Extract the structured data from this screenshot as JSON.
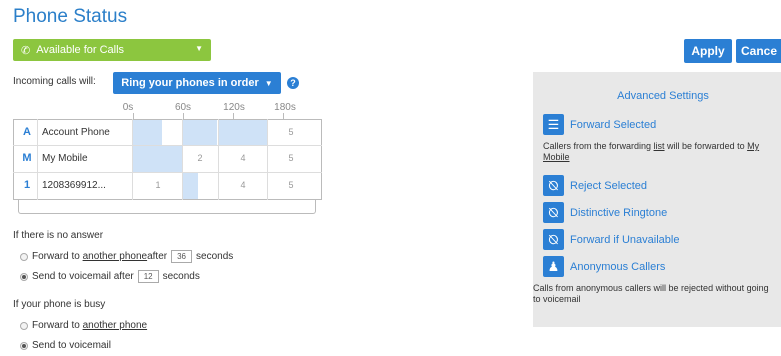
{
  "page_title": "Phone Status",
  "status": {
    "label": "Available for Calls"
  },
  "buttons": {
    "apply": "Apply",
    "cancel": "Cance"
  },
  "incoming": {
    "label": "Incoming calls will:",
    "mode": "Ring your phones in order",
    "help": "?"
  },
  "timeline": {
    "ticks": [
      "0s",
      "60s",
      "120s",
      "180s"
    ]
  },
  "phones": [
    {
      "key": "A",
      "name": "Account Phone",
      "cells": [
        "",
        "",
        "",
        "5"
      ]
    },
    {
      "key": "M",
      "name": "My Mobile",
      "cells": [
        "",
        "2",
        "4",
        "5"
      ]
    },
    {
      "key": "1",
      "name": "1208369912...",
      "cells": [
        "1",
        "",
        "4",
        "5"
      ]
    }
  ],
  "no_answer": {
    "heading": "If there is no answer",
    "opt1_pre": "Forward to ",
    "opt1_link": "another phone",
    "opt1_mid": " after",
    "opt1_seconds": "36",
    "opt1_post": "seconds",
    "opt2_pre": "Send to voicemail after",
    "opt2_seconds": "12",
    "opt2_post": "seconds"
  },
  "busy": {
    "heading": "If your phone is busy",
    "opt1_pre": "Forward to ",
    "opt1_link": "another phone",
    "opt2": "Send to voicemail"
  },
  "advanced": {
    "title": "Advanced Settings",
    "forward_selected": "Forward Selected",
    "forward_note_1": "Callers from the forwarding ",
    "forward_note_link1": "list",
    "forward_note_2": " will be forwarded to ",
    "forward_note_link2": "My Mobile",
    "reject_selected": "Reject Selected",
    "distinctive_ringtone": "Distinctive Ringtone",
    "forward_unavailable": "Forward if Unavailable",
    "anonymous_callers": "Anonymous Callers",
    "anonymous_note": "Calls from anonymous callers will be rejected without going to voicemail"
  },
  "colors": {
    "accent": "#2b7fd4",
    "status_green": "#8cc63f",
    "cell_blue": "#cfe2f7"
  }
}
